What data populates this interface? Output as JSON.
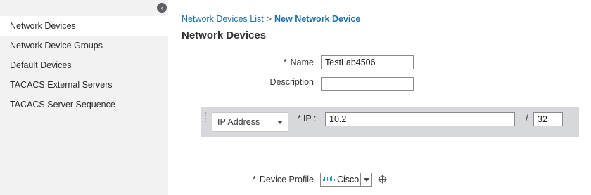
{
  "sidebar": {
    "collapse_glyph": "‹",
    "items": [
      {
        "label": "Network Devices",
        "active": true
      },
      {
        "label": "Network Device Groups"
      },
      {
        "label": "Default Devices"
      },
      {
        "label": "TACACS External Servers"
      },
      {
        "label": "TACACS Server Sequence"
      }
    ]
  },
  "breadcrumb": {
    "parent": "Network Devices List",
    "separator": ">",
    "current": "New Network Device"
  },
  "page_title": "Network Devices",
  "form": {
    "required_mark": "*",
    "name_label": "Name",
    "name_value": "TestLab4506",
    "description_label": "Description",
    "description_value": "",
    "ip_type_value": "IP Address",
    "ip_label": "IP :",
    "ip_value": "10.2",
    "mask_separator": "/",
    "mask_value": "32",
    "device_profile_label": "Device Profile",
    "device_profile_value": "Cisco"
  },
  "colors": {
    "link": "#1a6fb0",
    "sidebar_bg": "#f2f2f3",
    "ip_band_bg": "#d6d8db",
    "cisco_logo": "#1b9ad6"
  },
  "icons": {
    "collapse": "chevron-left-icon",
    "drag": "drag-handle-icon",
    "dropdown": "caret-down-icon",
    "logo": "cisco-logo-icon",
    "crosshair": "crosshair-icon"
  }
}
